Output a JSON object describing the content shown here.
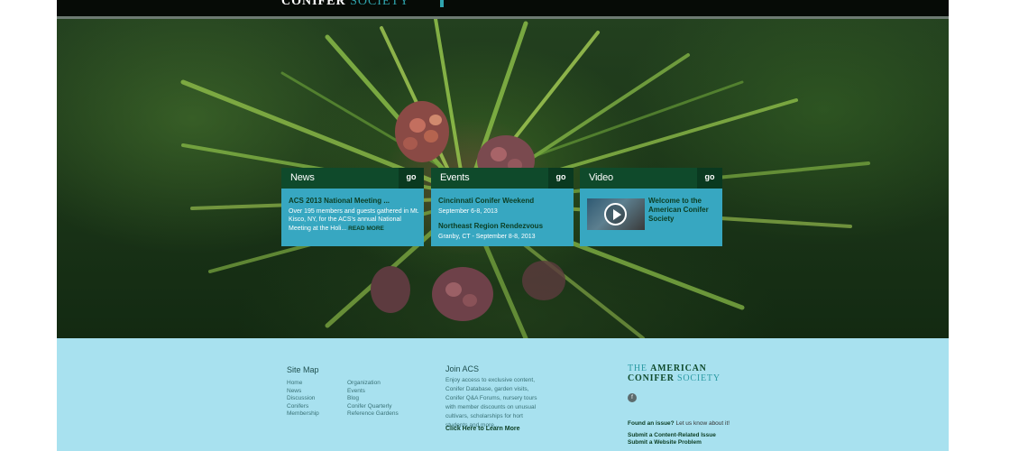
{
  "header": {
    "logo_word1": "CONIFER",
    "logo_word2": "SOCIETY"
  },
  "hero": {
    "image": "conifer-pine-cone-photo"
  },
  "cards": {
    "news": {
      "title": "News",
      "go": "go",
      "headline": "ACS 2013 National Meeting ...",
      "text": "Over 195 members and guests gathered in Mt. Kisco, NY, for the ACS's annual National Meeting at the Holi...",
      "read_more": "READ MORE"
    },
    "events": {
      "title": "Events",
      "go": "go",
      "event1_title": "Cincinnati Conifer Weekend",
      "event1_date": "September 6-8, 2013",
      "event2_title": "Northeast Region Rendezvous",
      "event2_date": "Granby, CT - September 8-8, 2013"
    },
    "video": {
      "title": "Video",
      "go": "go",
      "caption": "Welcome to the American Conifer Society"
    }
  },
  "footer": {
    "sitemap": {
      "heading": "Site Map",
      "col1": [
        "Home",
        "News",
        "Discussion",
        "Conifers",
        "Membership"
      ],
      "col2": [
        "Organization",
        "Events",
        "Blog",
        "Conifer Quarterly",
        "Reference Gardens"
      ]
    },
    "join": {
      "heading": "Join ACS",
      "text": "Enjoy access to exclusive content, Conifer Database, garden visits, Conifer Q&A Forums, nursery tours with member discounts on unusual cultivars, scholarships for hort students and more...",
      "cta": "Click Here to Learn More"
    },
    "logo": {
      "line1a": "THE",
      "line1b": "AMERICAN",
      "line2a": "CONIFER",
      "line2b": "SOCIETY"
    },
    "social_icon": "facebook-icon",
    "issue_bold": "Found an issue?",
    "issue_rest": " Let us know about it!",
    "submit_content": "Submit a Content-Related Issue",
    "submit_website": "Submit a Website Problem"
  },
  "colors": {
    "header_bg": "#060b06",
    "card_head": "#0f4a2b",
    "card_body": "#37a7c1",
    "footer_bg": "#a8e1ef",
    "accent": "#2fa4ad"
  }
}
